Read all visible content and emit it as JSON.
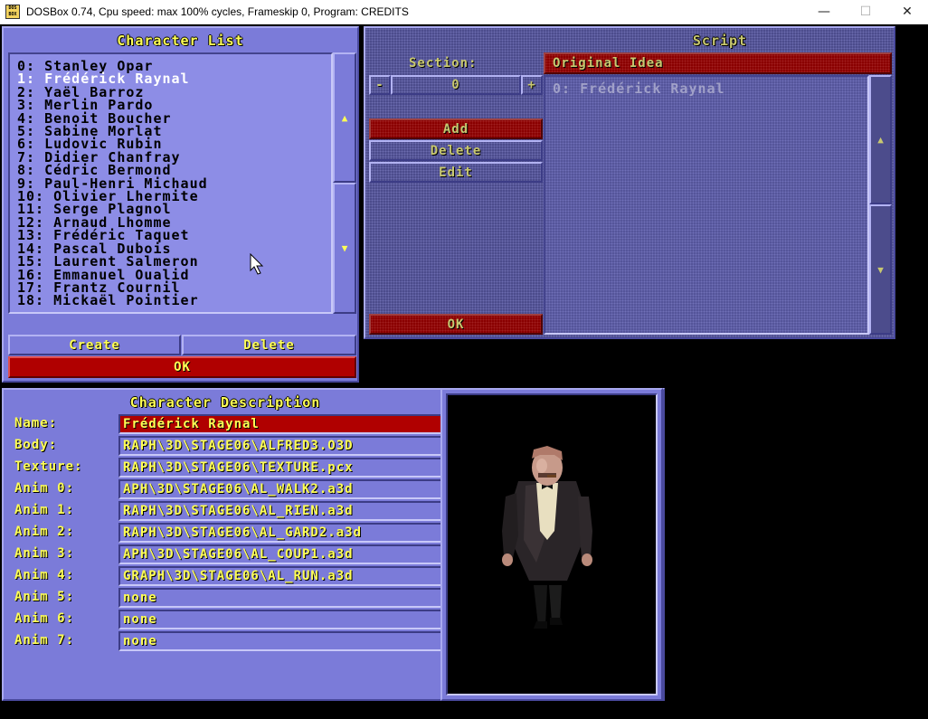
{
  "window": {
    "title": "DOSBox 0.74, Cpu speed: max 100% cycles, Frameskip  0, Program:  CREDITS",
    "icon_text": "DOS BOX",
    "minimize_glyph": "—",
    "maximize_glyph": "☐",
    "close_glyph": "✕"
  },
  "character_list": {
    "title": "Character List",
    "items": [
      "0: Stanley Opar",
      "1: Frédérick Raynal",
      "2: Yaël Barroz",
      "3: Merlin Pardo",
      "4: Benoit Boucher",
      "5: Sabine Morlat",
      "6: Ludovic Rubin",
      "7: Didier Chanfray",
      "8: Cédric Bermond",
      "9: Paul-Henri Michaud",
      "10: Olivier Lhermite",
      "11: Serge Plagnol",
      "12: Arnaud Lhomme",
      "13: Frédéric Taquet",
      "14: Pascal Dubois",
      "15: Laurent Salmeron",
      "16: Emmanuel Oualid",
      "17: Frantz Cournil",
      "18: Mickaël Pointier"
    ],
    "selected_index": 1,
    "scroll_up_glyph": "▲",
    "scroll_down_glyph": "▼",
    "create_label": "Create",
    "delete_label": "Delete",
    "ok_label": "OK"
  },
  "script": {
    "title": "Script",
    "section_label": "Section:",
    "section_value": "0",
    "section_name": "Original Idea",
    "dec_glyph": "-",
    "inc_glyph": "+",
    "add_label": "Add",
    "delete_label": "Delete",
    "edit_label": "Edit",
    "ok_label": "OK",
    "lines": [
      "0: Frédérick Raynal"
    ],
    "scroll_up_glyph": "▲",
    "scroll_down_glyph": "▼"
  },
  "description": {
    "title": "Character Description",
    "fields": [
      {
        "label": "Name:",
        "value": "Frédérick Raynal",
        "highlight": true
      },
      {
        "label": "Body:",
        "value": "RAPH\\3D\\STAGE06\\ALFRED3.O3D"
      },
      {
        "label": "Texture:",
        "value": "RAPH\\3D\\STAGE06\\TEXTURE.pcx"
      },
      {
        "label": "Anim 0:",
        "value": "APH\\3D\\STAGE06\\AL_WALK2.a3d"
      },
      {
        "label": "Anim 1:",
        "value": "RAPH\\3D\\STAGE06\\AL_RIEN.a3d"
      },
      {
        "label": "Anim 2:",
        "value": "RAPH\\3D\\STAGE06\\AL_GARD2.a3d"
      },
      {
        "label": "Anim 3:",
        "value": "APH\\3D\\STAGE06\\AL_COUP1.a3d"
      },
      {
        "label": "Anim 4:",
        "value": "GRAPH\\3D\\STAGE06\\AL_RUN.a3d"
      },
      {
        "label": "Anim 5:",
        "value": "none"
      },
      {
        "label": "Anim 6:",
        "value": "none"
      },
      {
        "label": "Anim 7:",
        "value": "none"
      }
    ]
  },
  "colors": {
    "panel": "#7b7bd9",
    "accent_text": "#ffff55",
    "highlight": "#b00000"
  }
}
